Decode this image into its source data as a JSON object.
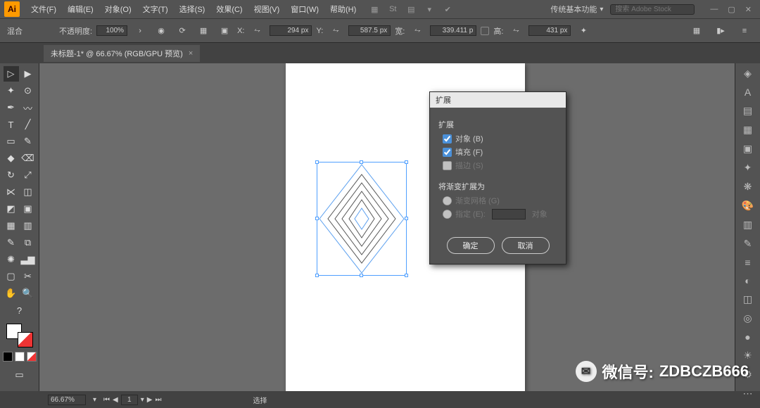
{
  "app_icon": "Ai",
  "menus": [
    "文件(F)",
    "编辑(E)",
    "对象(O)",
    "文字(T)",
    "选择(S)",
    "效果(C)",
    "视图(V)",
    "窗口(W)",
    "帮助(H)"
  ],
  "workspace_dropdown": "传统基本功能",
  "search_placeholder": "搜索 Adobe Stock",
  "window_controls": [
    "—",
    "▢",
    "✕"
  ],
  "controlbar": {
    "blend_label": "混合",
    "opacity_label": "不透明度:",
    "opacity_value": "100%",
    "x_label": "X:",
    "x_value": "294 px",
    "y_label": "Y:",
    "y_value": "587.5 px",
    "w_label": "宽:",
    "w_value": "339.411 p",
    "h_label": "高:",
    "h_value": "431 px"
  },
  "document_tab": {
    "title": "未标题-1* @ 66.67% (RGB/GPU 预览)",
    "close": "×"
  },
  "dialog": {
    "title": "扩展",
    "section_expand": "扩展",
    "cb_object": "对象 (B)",
    "cb_fill": "填充 (F)",
    "cb_stroke": "描边 (S)",
    "section_gradient": "将渐变扩展为",
    "rd_mesh": "渐变网格 (G)",
    "rd_specify": "指定 (E):",
    "rd_specify_suffix": "对象",
    "btn_ok": "确定",
    "btn_cancel": "取消"
  },
  "statusbar": {
    "zoom": "66.67%",
    "page": "1",
    "status_text": "选择"
  },
  "watermark": {
    "label": "微信号:",
    "value": "ZDBCZB666"
  },
  "right_panel_icons": [
    "layers",
    "type",
    "align",
    "guide",
    "shape",
    "sym",
    "pat",
    "color",
    "swatch",
    "brush",
    "stroke",
    "grad",
    "trans",
    "app",
    "art",
    "lib",
    "dot",
    "sun",
    "gear",
    "more"
  ]
}
